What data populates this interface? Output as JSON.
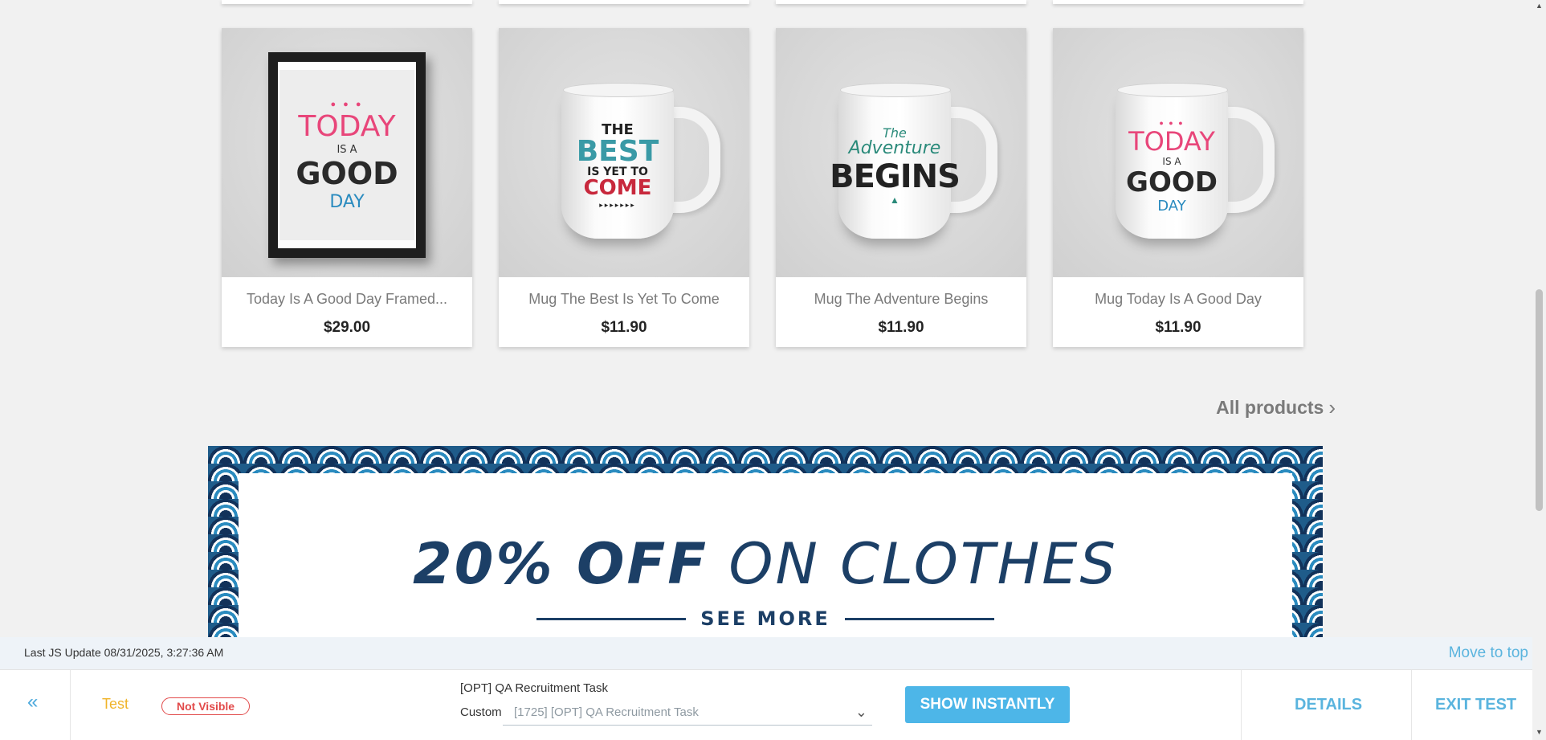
{
  "products": [
    {
      "name": "Today Is A Good Day Framed...",
      "price": "$29.00",
      "art": [
        "TODAY",
        "IS A",
        "GOOD",
        "DAY"
      ]
    },
    {
      "name": "Mug The Best Is Yet To Come",
      "price": "$11.90",
      "art": [
        "THE",
        "BEST",
        "IS YET TO",
        "COME"
      ]
    },
    {
      "name": "Mug The Adventure Begins",
      "price": "$11.90",
      "art": [
        "The",
        "Adventure",
        "BEGINS"
      ]
    },
    {
      "name": "Mug Today Is A Good Day",
      "price": "$11.90",
      "art": [
        "TODAY",
        "IS A",
        "GOOD",
        "DAY"
      ]
    }
  ],
  "all_products": {
    "label": "All products"
  },
  "banner": {
    "headline_bold": "20% OFF",
    "headline_rest": " ON CLOTHES",
    "cta": "SEE MORE"
  },
  "infobar": {
    "last_update": "Last JS Update 08/31/2025, 3:27:36 AM",
    "move_top": "Move to top"
  },
  "toolbar": {
    "collapse_icon": "«",
    "variant": "Test",
    "visibility": "Not Visible",
    "task_title": "[OPT] QA Recruitment Task",
    "custom_label": "Custom",
    "task_select": "[1725] [OPT] QA Recruitment Task",
    "show_button": "SHOW INSTANTLY",
    "details": "DETAILS",
    "exit": "EXIT TEST"
  },
  "colors": {
    "accent": "#4db6e8",
    "badge": "#e24b4b",
    "variant": "#f0b429",
    "banner_navy": "#1c3f66"
  }
}
